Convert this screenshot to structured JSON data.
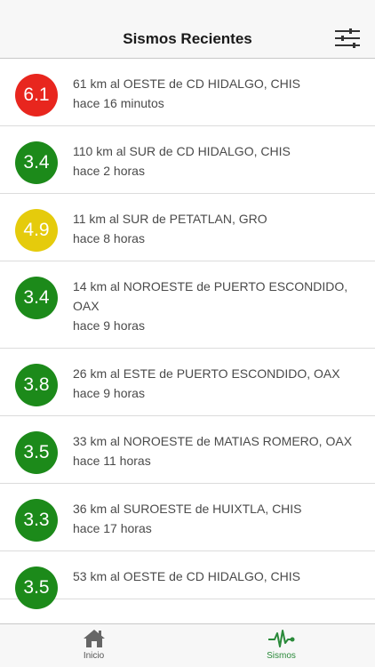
{
  "header": {
    "title": "Sismos Recientes",
    "filter_icon": "sliders-icon"
  },
  "colors": {
    "high": "#e8261e",
    "low": "#1c8a1a",
    "medium": "#e5cb0c",
    "active_tab": "#2a8a3a"
  },
  "earthquakes": [
    {
      "magnitude": "6.1",
      "level": "red",
      "location": "61 km al OESTE de CD HIDALGO, CHIS",
      "time": "hace 16 minutos"
    },
    {
      "magnitude": "3.4",
      "level": "green",
      "location": "110 km al SUR de CD HIDALGO, CHIS",
      "time": "hace 2 horas"
    },
    {
      "magnitude": "4.9",
      "level": "yellow",
      "location": "11 km al SUR de PETATLAN, GRO",
      "time": "hace 8 horas"
    },
    {
      "magnitude": "3.4",
      "level": "green",
      "location": "14 km al NOROESTE de PUERTO ESCONDIDO, OAX",
      "time": "hace 9 horas"
    },
    {
      "magnitude": "3.8",
      "level": "green",
      "location": "26 km al ESTE de PUERTO ESCONDIDO, OAX",
      "time": "hace 9 horas"
    },
    {
      "magnitude": "3.5",
      "level": "green",
      "location": "33 km al NOROESTE de MATIAS ROMERO, OAX",
      "time": "hace 11 horas"
    },
    {
      "magnitude": "3.3",
      "level": "green",
      "location": "36 km al SUROESTE de HUIXTLA, CHIS",
      "time": "hace 17 horas"
    },
    {
      "magnitude": "3.5",
      "level": "green",
      "location": "53 km al OESTE de CD HIDALGO, CHIS",
      "time": ""
    }
  ],
  "tabbar": {
    "tabs": [
      {
        "label": "Inicio",
        "icon": "home-icon",
        "active": false
      },
      {
        "label": "Sismos",
        "icon": "seismograph-icon",
        "active": true
      }
    ]
  }
}
